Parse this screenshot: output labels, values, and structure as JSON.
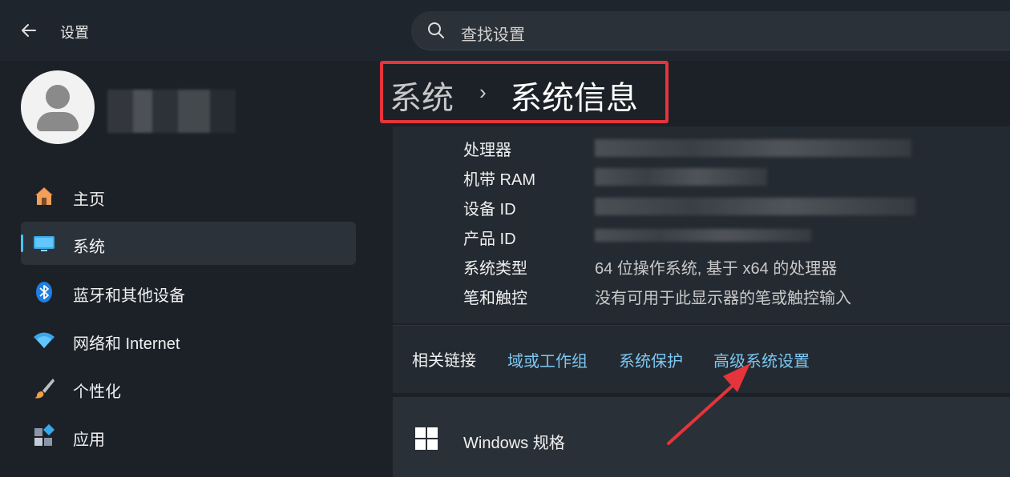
{
  "window": {
    "title": "设置"
  },
  "search": {
    "placeholder": "查找设置"
  },
  "breadcrumb": {
    "parent": "系统",
    "separator": "›",
    "current": "系统信息"
  },
  "sidebar": {
    "items": [
      {
        "label": "主页",
        "icon": "home-icon"
      },
      {
        "label": "系统",
        "icon": "system-display-icon",
        "active": true
      },
      {
        "label": "蓝牙和其他设备",
        "icon": "bluetooth-icon"
      },
      {
        "label": "网络和 Internet",
        "icon": "wifi-icon"
      },
      {
        "label": "个性化",
        "icon": "paintbrush-icon"
      },
      {
        "label": "应用",
        "icon": "apps-icon"
      }
    ]
  },
  "specs": [
    {
      "label": "处理器",
      "value": ""
    },
    {
      "label": "机带 RAM",
      "value": ""
    },
    {
      "label": "设备 ID",
      "value": ""
    },
    {
      "label": "产品 ID",
      "value": ""
    },
    {
      "label": "系统类型",
      "value": "64 位操作系统, 基于 x64 的处理器"
    },
    {
      "label": "笔和触控",
      "value": "没有可用于此显示器的笔或触控输入"
    }
  ],
  "related_links": {
    "title": "相关链接",
    "links": [
      "域或工作组",
      "系统保护",
      "高级系统设置"
    ]
  },
  "windows_spec": {
    "label": "Windows 规格"
  },
  "colors": {
    "accent": "#4cc2ff",
    "link": "#7cc7f2",
    "highlight_box": "#e5343b",
    "annotation_arrow": "#e5343b"
  }
}
